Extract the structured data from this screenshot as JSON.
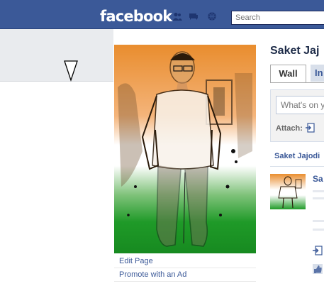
{
  "header": {
    "logo": "facebook",
    "search_placeholder": "Search"
  },
  "left_column": {
    "links": [
      "Edit Page",
      "Promote with an Ad"
    ]
  },
  "profile": {
    "name": "Saket Jaj",
    "tabs": [
      "Wall",
      "In"
    ],
    "composer": {
      "placeholder": "What's on y",
      "attach_label": "Attach:"
    },
    "filter_label": "Saket Jajodi",
    "story_author": "Sa"
  },
  "colors": {
    "brand": "#3b5998",
    "saffron": "#e98d2e",
    "india_green": "#1f9a28"
  },
  "icons": [
    "friends-icon",
    "messages-icon",
    "notifications-icon",
    "attach-icon",
    "like-icon"
  ]
}
